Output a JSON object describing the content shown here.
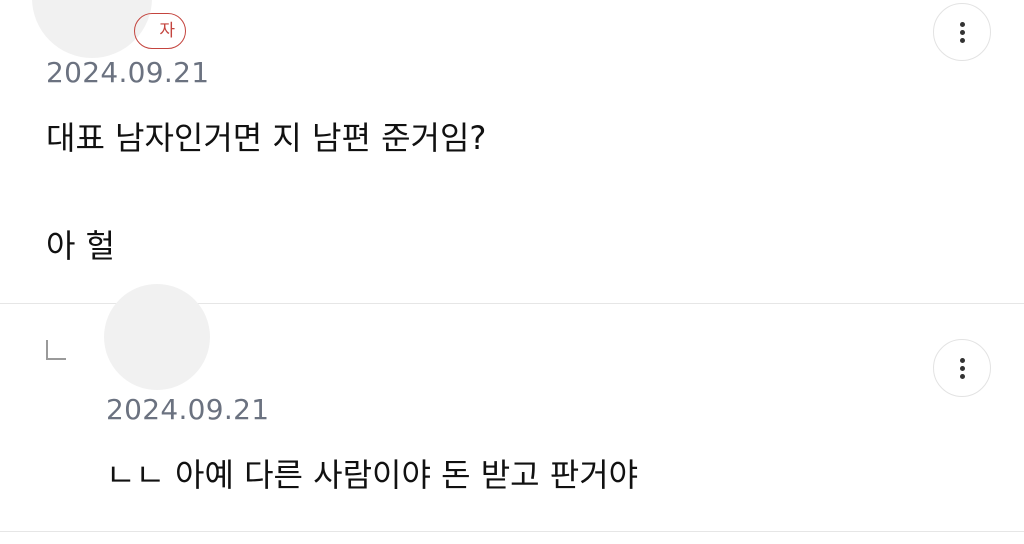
{
  "comments": [
    {
      "badge": "자",
      "date": "2024.09.21",
      "lines": [
        "대표 남자인거면 지 남편 준거임?",
        "아 헐"
      ],
      "more_icon": "more-vertical-icon"
    },
    {
      "is_reply": true,
      "reply_icon": "reply-arrow-icon",
      "date": "2024.09.21",
      "lines": [
        "ㄴㄴ 아예 다른 사람이야 돈 받고 판거야"
      ],
      "more_icon": "more-vertical-icon"
    }
  ],
  "colors": {
    "badge": "#c4443e",
    "date": "#6b7280",
    "text": "#111111",
    "divider": "#e6e6e6"
  }
}
